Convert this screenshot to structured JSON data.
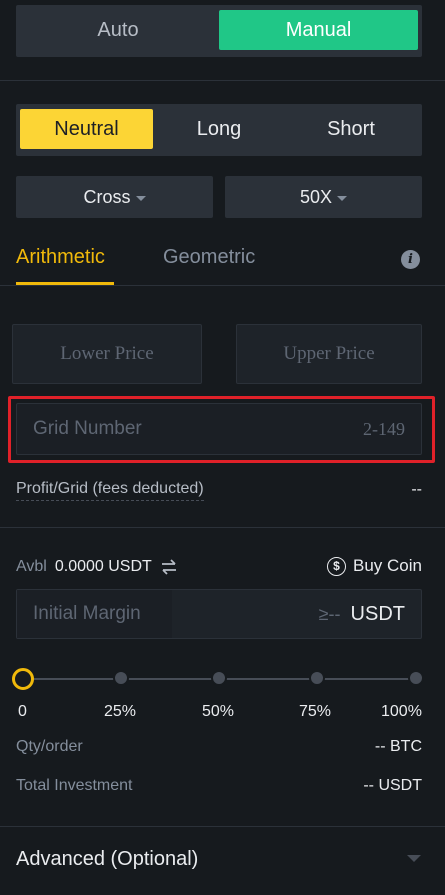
{
  "mode_toggle": {
    "auto": "Auto",
    "manual": "Manual"
  },
  "direction": {
    "neutral": "Neutral",
    "long": "Long",
    "short": "Short"
  },
  "margin_mode": {
    "value": "Cross"
  },
  "leverage": {
    "value": "50X"
  },
  "tabs": {
    "arithmetic": "Arithmetic",
    "geometric": "Geometric"
  },
  "price": {
    "lower_placeholder": "Lower Price",
    "upper_placeholder": "Upper Price"
  },
  "grid": {
    "placeholder": "Grid Number",
    "range_hint": "2-149"
  },
  "profit": {
    "label": "Profit/Grid (fees deducted)",
    "value": "--"
  },
  "available": {
    "label": "Avbl",
    "value": "0.0000 USDT"
  },
  "buy_coin": {
    "label": "Buy Coin"
  },
  "initial_margin": {
    "placeholder": "Initial Margin",
    "hint": "≥--",
    "unit": "USDT"
  },
  "slider": {
    "value_fraction": 0,
    "ticks": [
      "0",
      "25%",
      "50%",
      "75%",
      "100%"
    ]
  },
  "qty": {
    "label": "Qty/order",
    "value": "-- BTC"
  },
  "investment": {
    "label": "Total Investment",
    "value": "-- USDT"
  },
  "advanced": {
    "label": "Advanced (Optional)"
  },
  "colors": {
    "accent_green": "#20c787",
    "accent_yellow": "#f0b90b",
    "highlight_red": "#e02129",
    "background": "#161a1e"
  }
}
